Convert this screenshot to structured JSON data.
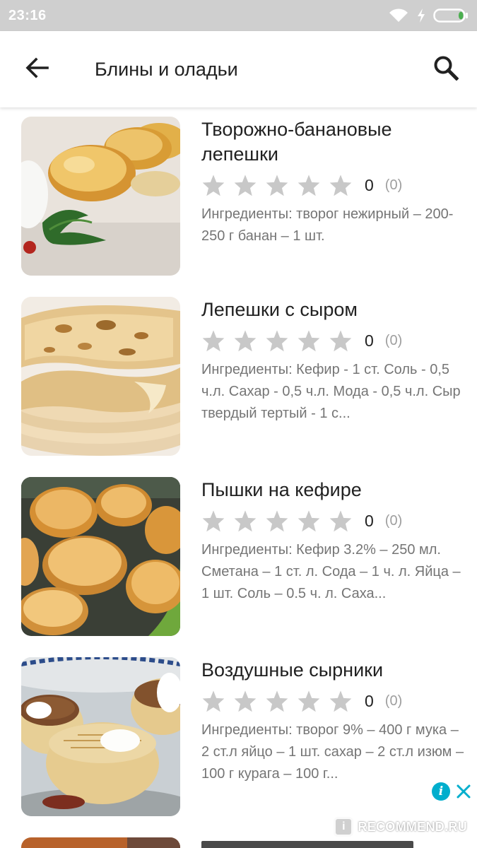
{
  "status_bar": {
    "time": "23:16",
    "icons": [
      "wifi-icon",
      "charging-icon",
      "battery-icon"
    ]
  },
  "app_bar": {
    "title": "Блины и оладьи",
    "back_icon": "arrow-back-icon",
    "search_icon": "search-icon"
  },
  "colors": {
    "star": "#c8c8c8",
    "ingredients_text": "#757575",
    "ad_info": "#00aecd",
    "battery_fill": "#4caf50"
  },
  "recipes": [
    {
      "title": "Творожно-банановые лепешки",
      "rating": "0",
      "count": "(0)",
      "stars": 0,
      "ingredients": "Ингредиенты: творог нежирный – 200-250 г банан – 1 шт."
    },
    {
      "title": "Лепешки с сыром",
      "rating": "0",
      "count": "(0)",
      "stars": 0,
      "ingredients": "Ингредиенты: Кефир - 1 ст. Соль - 0,5 ч.л. Сахар - 0,5 ч.л. Мода - 0,5 ч.л. Сыр твердый тертый - 1 с..."
    },
    {
      "title": "Пышки на кефире",
      "rating": "0",
      "count": "(0)",
      "stars": 0,
      "ingredients": "Ингредиенты: Кефир 3.2% – 250 мл. Сметана – 1 ст. л.  Сода – 1 ч. л.  Яйца – 1 шт.  Соль – 0.5 ч. л. Саха..."
    },
    {
      "title": "Воздушные сырники",
      "rating": "0",
      "count": "(0)",
      "stars": 0,
      "ingredients": "Ингредиенты: творог 9% – 400 г мука – 2 ст.л яйцо – 1 шт. сахар – 2 ст.л изюм – 100 г курага – 100 г..."
    }
  ],
  "ad": {
    "info_icon": "i",
    "close_icon": "close-icon"
  },
  "watermark": {
    "text": "RECOMMEND.RU",
    "logo": "i"
  }
}
